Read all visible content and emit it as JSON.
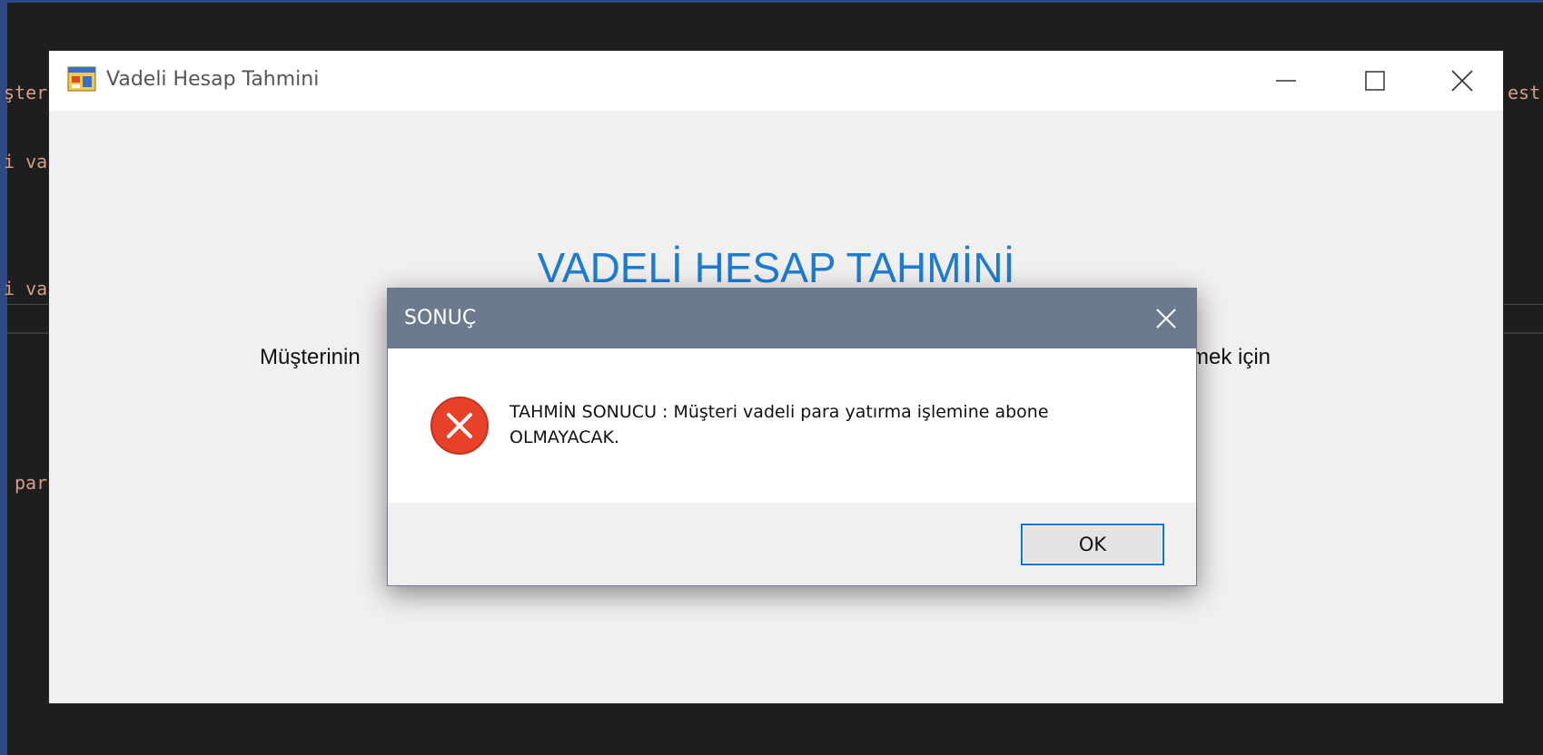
{
  "background_code": {
    "left_fragments": [
      "şter",
      "i va",
      "i va",
      "par"
    ],
    "right_fragments": [
      "est"
    ]
  },
  "window": {
    "title": "Vadeli Hesap Tahmini",
    "heading": "VADELİ HESAP TAHMİNİ",
    "body_text_left": "Müşterinin",
    "body_text_right": "rmek için"
  },
  "dialog": {
    "title": "SONUÇ",
    "message": "TAHMİN SONUCU : Müşteri vadeli para yatırma işlemine abone OLMAYACAK.",
    "ok_label": "OK",
    "icon": "error-icon"
  },
  "colors": {
    "heading": "#1f7bd1",
    "dialog_titlebar": "#6b7a8f",
    "error_red": "#e8412a",
    "ok_border": "#0a74d8"
  }
}
